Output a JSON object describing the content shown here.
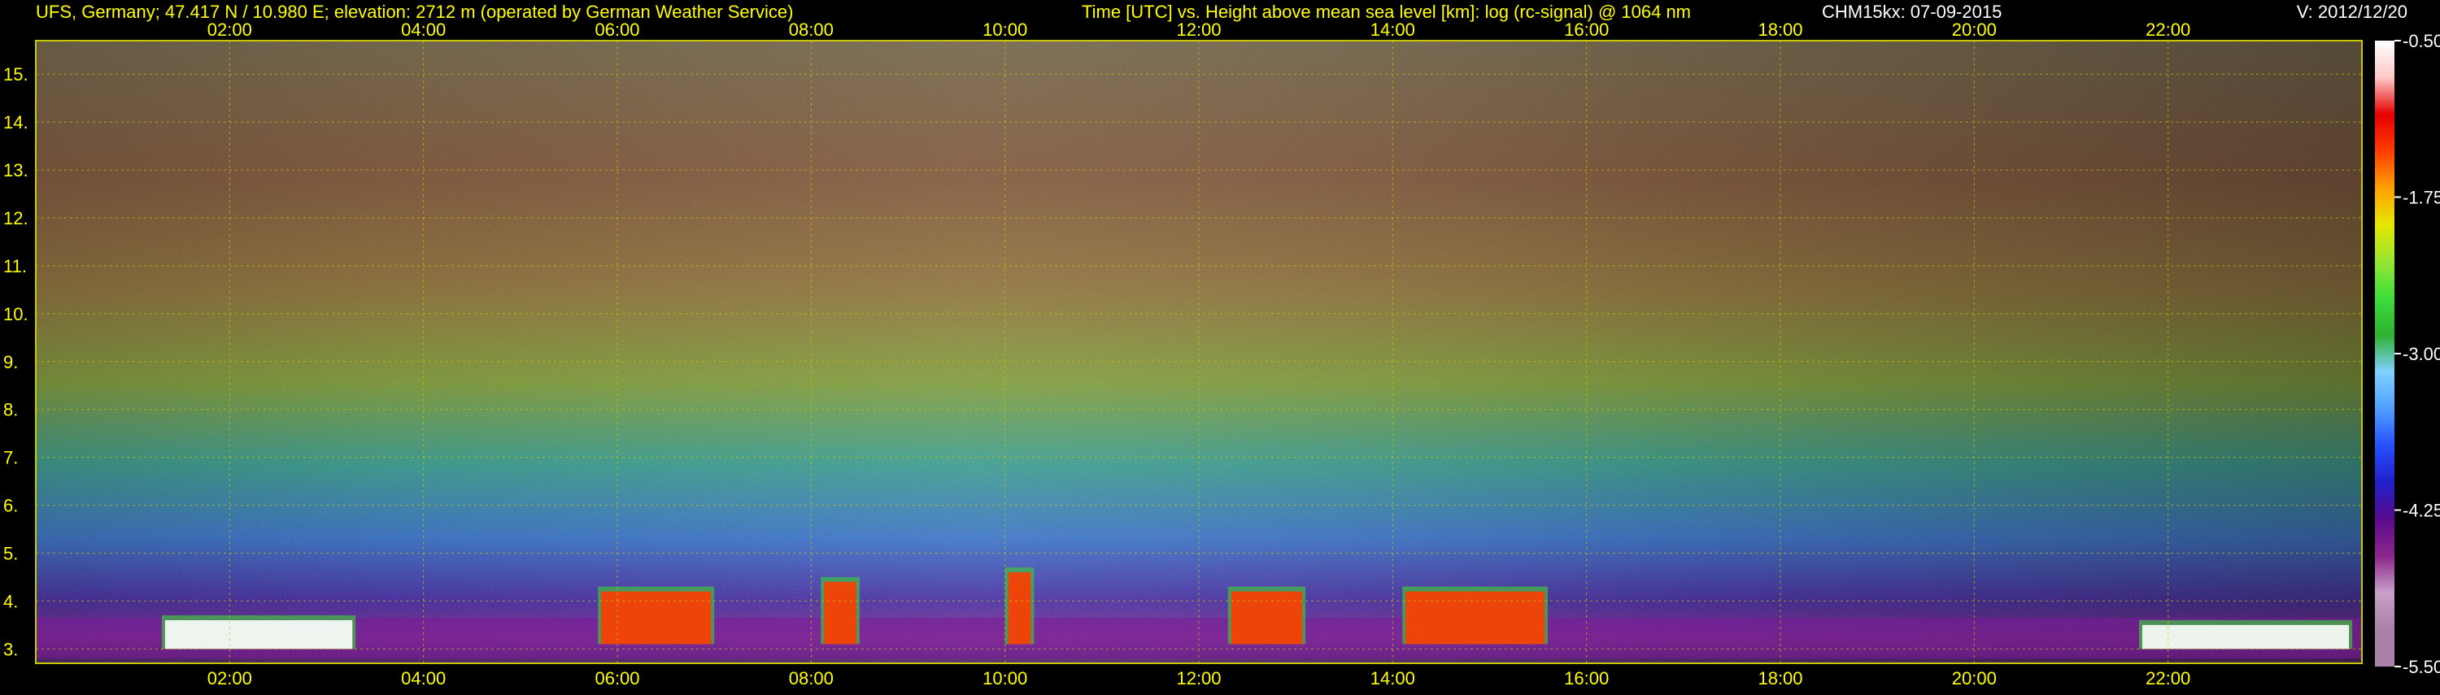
{
  "header": {
    "site": "UFS, Germany; 47.417 N / 10.980 E; elevation: 2712 m  (operated by German Weather Service)",
    "title": "Time [UTC] vs. Height above mean sea level [km]: log (rc-signal) @ 1064 nm",
    "instrument": "CHM15kx: 07-09-2015",
    "version": "V: 2012/12/20"
  },
  "colors": {
    "background": "#000000",
    "text_yellow": "#ffff00",
    "text_white": "#ffffff",
    "grid": "#c8c800"
  },
  "chart_data": {
    "type": "heatmap",
    "title": "Time [UTC] vs. Height above mean sea level [km]: log (rc-signal) @ 1064 nm",
    "x_ticks": [
      "02:00",
      "04:00",
      "06:00",
      "08:00",
      "10:00",
      "12:00",
      "14:00",
      "16:00",
      "18:00",
      "20:00",
      "22:00"
    ],
    "x_tick_hours": [
      2,
      4,
      6,
      8,
      10,
      12,
      14,
      16,
      18,
      20,
      22
    ],
    "xlim_hours": [
      0,
      24
    ],
    "y_ticks": [
      "3.",
      "4.",
      "5.",
      "6.",
      "7.",
      "8.",
      "9.",
      "10.",
      "11.",
      "12.",
      "13.",
      "14.",
      "15."
    ],
    "y_tick_values": [
      3,
      4,
      5,
      6,
      7,
      8,
      9,
      10,
      11,
      12,
      13,
      14,
      15
    ],
    "ylim_km": [
      2.7,
      15.7
    ],
    "grid": true,
    "colorbar": {
      "ticks": [
        "-0.50",
        "-1.75",
        "-3.00",
        "-4.25",
        "-5.50"
      ],
      "tick_values": [
        -0.5,
        -1.75,
        -3.0,
        -4.25,
        -5.5
      ],
      "range": [
        -5.5,
        -0.5
      ],
      "stops": [
        "#a882a8",
        "#a882a8",
        "#c8a0c8",
        "#8c288c",
        "#5a0a8c",
        "#2020c8",
        "#2850ff",
        "#50a0ff",
        "#80d0ff",
        "#30b030",
        "#3cdc3c",
        "#96e632",
        "#e6e600",
        "#ffa000",
        "#ff3c00",
        "#e60000",
        "#ffc8c8",
        "#ffffff"
      ]
    },
    "cloud_layers": [
      {
        "start_h": 1.3,
        "end_h": 3.3,
        "base_km": 3.0,
        "top_km": 3.6,
        "color": "#ffffff"
      },
      {
        "start_h": 5.8,
        "end_h": 7.0,
        "base_km": 3.1,
        "top_km": 4.2,
        "color": "#ff3c00"
      },
      {
        "start_h": 8.1,
        "end_h": 8.5,
        "base_km": 3.1,
        "top_km": 4.4,
        "color": "#ff3c00"
      },
      {
        "start_h": 10.0,
        "end_h": 10.3,
        "base_km": 3.1,
        "top_km": 4.6,
        "color": "#ff3c00"
      },
      {
        "start_h": 12.3,
        "end_h": 13.1,
        "base_km": 3.1,
        "top_km": 4.2,
        "color": "#ff3c00"
      },
      {
        "start_h": 14.1,
        "end_h": 15.6,
        "base_km": 3.1,
        "top_km": 4.2,
        "color": "#ff3c00"
      },
      {
        "start_h": 21.7,
        "end_h": 23.9,
        "base_km": 3.0,
        "top_km": 3.5,
        "color": "#ffffff"
      }
    ]
  }
}
